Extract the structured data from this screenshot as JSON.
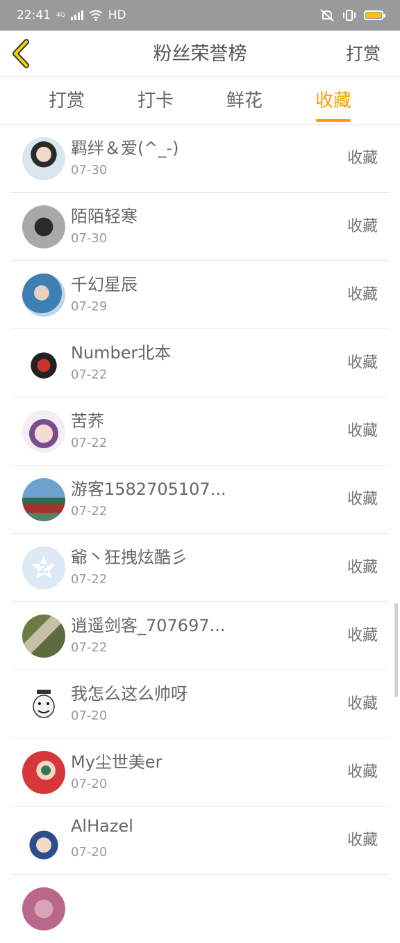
{
  "status": {
    "time": "22:41",
    "net": "4G",
    "hd": "HD"
  },
  "header": {
    "title": "粉丝荣誉榜",
    "right_action": "打赏"
  },
  "tabs": [
    {
      "label": "打赏",
      "active": false
    },
    {
      "label": "打卡",
      "active": false
    },
    {
      "label": "鲜花",
      "active": false
    },
    {
      "label": "收藏",
      "active": true
    }
  ],
  "accent_color": "#f5a000",
  "fans": [
    {
      "name": "羁绊＆爱(^_-)",
      "date": "07-30",
      "action": "收藏"
    },
    {
      "name": "陌陌轻寒",
      "date": "07-30",
      "action": "收藏"
    },
    {
      "name": "千幻星辰",
      "date": "07-29",
      "action": "收藏"
    },
    {
      "name": "Number北本",
      "date": "07-22",
      "action": "收藏"
    },
    {
      "name": "苦荞",
      "date": "07-22",
      "action": "收藏"
    },
    {
      "name": "游客1582705107...",
      "date": "07-22",
      "action": "收藏"
    },
    {
      "name": "爺丶狂拽炫酷彡",
      "date": "07-22",
      "action": "收藏"
    },
    {
      "name": "逍遥剑客_707697...",
      "date": "07-22",
      "action": "收藏"
    },
    {
      "name": "我怎么这么帅呀",
      "date": "07-20",
      "action": "收藏"
    },
    {
      "name": "My尘世美er",
      "date": "07-20",
      "action": "收藏"
    },
    {
      "name": "AlHazel",
      "date": "07-20",
      "action": "收藏"
    }
  ]
}
